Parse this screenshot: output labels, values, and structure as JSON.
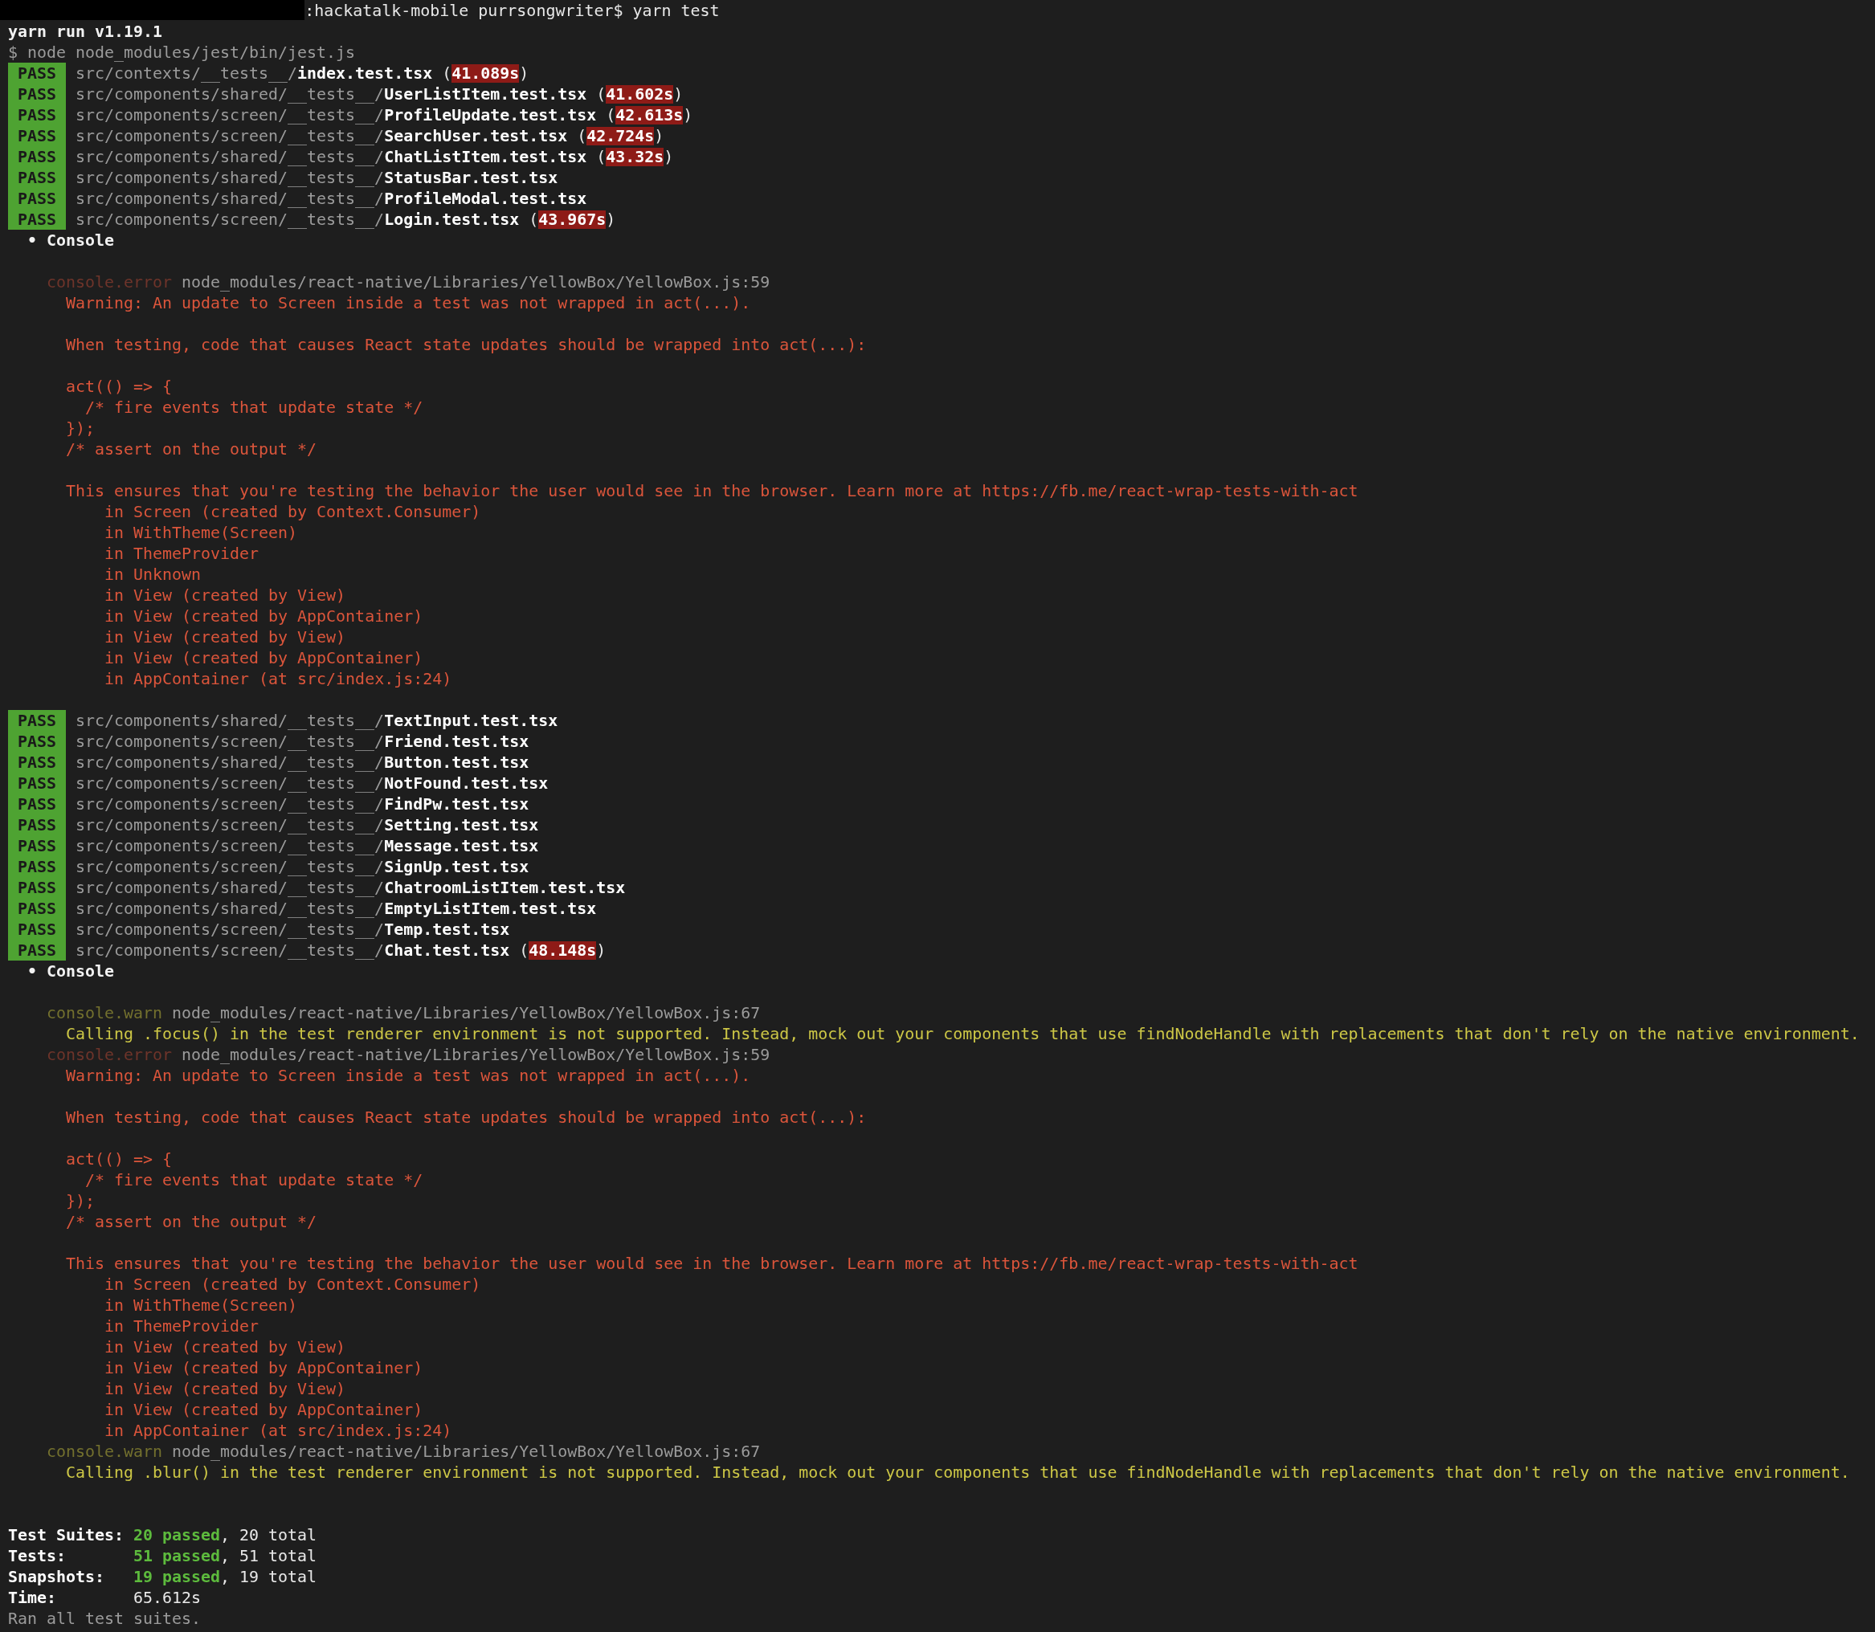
{
  "lines": [
    {
      "kind": "prompt",
      "segments": [
        {
          "kind": "plain",
          "text": ":hackatalk-mobile purrsongwriter$ yarn test"
        }
      ]
    },
    {
      "kind": "text",
      "segments": [
        {
          "kind": "heading",
          "text": "yarn run v1.19.1"
        }
      ]
    },
    {
      "kind": "text",
      "segments": [
        {
          "kind": "dim",
          "text": "$ node node_modules/jest/bin/jest.js"
        }
      ]
    },
    {
      "kind": "pass",
      "badge": "PASS",
      "segments": [
        {
          "kind": "dim",
          "text": "src/contexts/__tests__/"
        },
        {
          "kind": "bold",
          "text": "index.test.tsx"
        },
        {
          "kind": "plain",
          "text": " ("
        },
        {
          "kind": "slow",
          "text": "41.089s"
        },
        {
          "kind": "plain",
          "text": ")"
        }
      ]
    },
    {
      "kind": "pass",
      "badge": "PASS",
      "segments": [
        {
          "kind": "dim",
          "text": "src/components/shared/__tests__/"
        },
        {
          "kind": "bold",
          "text": "UserListItem.test.tsx"
        },
        {
          "kind": "plain",
          "text": " ("
        },
        {
          "kind": "slow",
          "text": "41.602s"
        },
        {
          "kind": "plain",
          "text": ")"
        }
      ]
    },
    {
      "kind": "pass",
      "badge": "PASS",
      "segments": [
        {
          "kind": "dim",
          "text": "src/components/screen/__tests__/"
        },
        {
          "kind": "bold",
          "text": "ProfileUpdate.test.tsx"
        },
        {
          "kind": "plain",
          "text": " ("
        },
        {
          "kind": "slow",
          "text": "42.613s"
        },
        {
          "kind": "plain",
          "text": ")"
        }
      ]
    },
    {
      "kind": "pass",
      "badge": "PASS",
      "segments": [
        {
          "kind": "dim",
          "text": "src/components/screen/__tests__/"
        },
        {
          "kind": "bold",
          "text": "SearchUser.test.tsx"
        },
        {
          "kind": "plain",
          "text": " ("
        },
        {
          "kind": "slow",
          "text": "42.724s"
        },
        {
          "kind": "plain",
          "text": ")"
        }
      ]
    },
    {
      "kind": "pass",
      "badge": "PASS",
      "segments": [
        {
          "kind": "dim",
          "text": "src/components/shared/__tests__/"
        },
        {
          "kind": "bold",
          "text": "ChatListItem.test.tsx"
        },
        {
          "kind": "plain",
          "text": " ("
        },
        {
          "kind": "slow",
          "text": "43.32s"
        },
        {
          "kind": "plain",
          "text": ")"
        }
      ]
    },
    {
      "kind": "pass",
      "badge": "PASS",
      "segments": [
        {
          "kind": "dim",
          "text": "src/components/shared/__tests__/"
        },
        {
          "kind": "bold",
          "text": "StatusBar.test.tsx"
        }
      ]
    },
    {
      "kind": "pass",
      "badge": "PASS",
      "segments": [
        {
          "kind": "dim",
          "text": "src/components/shared/__tests__/"
        },
        {
          "kind": "bold",
          "text": "ProfileModal.test.tsx"
        }
      ]
    },
    {
      "kind": "pass",
      "badge": "PASS",
      "segments": [
        {
          "kind": "dim",
          "text": "src/components/screen/__tests__/"
        },
        {
          "kind": "bold",
          "text": "Login.test.tsx"
        },
        {
          "kind": "plain",
          "text": " ("
        },
        {
          "kind": "slow",
          "text": "43.967s"
        },
        {
          "kind": "plain",
          "text": ")"
        }
      ]
    },
    {
      "kind": "text",
      "segments": [
        {
          "kind": "heading",
          "text": "  • Console"
        }
      ]
    },
    {
      "kind": "blank"
    },
    {
      "kind": "text",
      "segments": [
        {
          "kind": "errlabel",
          "text": "    console.error"
        },
        {
          "kind": "dim",
          "text": " node_modules/react-native/Libraries/YellowBox/YellowBox.js:59"
        }
      ]
    },
    {
      "kind": "text",
      "segments": [
        {
          "kind": "error",
          "text": "      Warning: An update to Screen inside a test was not wrapped in act(...)."
        }
      ]
    },
    {
      "kind": "blank"
    },
    {
      "kind": "text",
      "segments": [
        {
          "kind": "error",
          "text": "      When testing, code that causes React state updates should be wrapped into act(...):"
        }
      ]
    },
    {
      "kind": "blank"
    },
    {
      "kind": "text",
      "segments": [
        {
          "kind": "error",
          "text": "      act(() => {"
        }
      ]
    },
    {
      "kind": "text",
      "segments": [
        {
          "kind": "error",
          "text": "        /* fire events that update state */"
        }
      ]
    },
    {
      "kind": "text",
      "segments": [
        {
          "kind": "error",
          "text": "      });"
        }
      ]
    },
    {
      "kind": "text",
      "segments": [
        {
          "kind": "error",
          "text": "      /* assert on the output */"
        }
      ]
    },
    {
      "kind": "blank"
    },
    {
      "kind": "text",
      "segments": [
        {
          "kind": "error",
          "text": "      This ensures that you're testing the behavior the user would see in the browser. Learn more at https://fb.me/react-wrap-tests-with-act"
        }
      ]
    },
    {
      "kind": "text",
      "segments": [
        {
          "kind": "error",
          "text": "          in Screen (created by Context.Consumer)"
        }
      ]
    },
    {
      "kind": "text",
      "segments": [
        {
          "kind": "error",
          "text": "          in WithTheme(Screen)"
        }
      ]
    },
    {
      "kind": "text",
      "segments": [
        {
          "kind": "error",
          "text": "          in ThemeProvider"
        }
      ]
    },
    {
      "kind": "text",
      "segments": [
        {
          "kind": "error",
          "text": "          in Unknown"
        }
      ]
    },
    {
      "kind": "text",
      "segments": [
        {
          "kind": "error",
          "text": "          in View (created by View)"
        }
      ]
    },
    {
      "kind": "text",
      "segments": [
        {
          "kind": "error",
          "text": "          in View (created by AppContainer)"
        }
      ]
    },
    {
      "kind": "text",
      "segments": [
        {
          "kind": "error",
          "text": "          in View (created by View)"
        }
      ]
    },
    {
      "kind": "text",
      "segments": [
        {
          "kind": "error",
          "text": "          in View (created by AppContainer)"
        }
      ]
    },
    {
      "kind": "text",
      "segments": [
        {
          "kind": "error",
          "text": "          in AppContainer (at src/index.js:24)"
        }
      ]
    },
    {
      "kind": "blank"
    },
    {
      "kind": "pass",
      "badge": "PASS",
      "segments": [
        {
          "kind": "dim",
          "text": "src/components/shared/__tests__/"
        },
        {
          "kind": "bold",
          "text": "TextInput.test.tsx"
        }
      ]
    },
    {
      "kind": "pass",
      "badge": "PASS",
      "segments": [
        {
          "kind": "dim",
          "text": "src/components/screen/__tests__/"
        },
        {
          "kind": "bold",
          "text": "Friend.test.tsx"
        }
      ]
    },
    {
      "kind": "pass",
      "badge": "PASS",
      "segments": [
        {
          "kind": "dim",
          "text": "src/components/shared/__tests__/"
        },
        {
          "kind": "bold",
          "text": "Button.test.tsx"
        }
      ]
    },
    {
      "kind": "pass",
      "badge": "PASS",
      "segments": [
        {
          "kind": "dim",
          "text": "src/components/screen/__tests__/"
        },
        {
          "kind": "bold",
          "text": "NotFound.test.tsx"
        }
      ]
    },
    {
      "kind": "pass",
      "badge": "PASS",
      "segments": [
        {
          "kind": "dim",
          "text": "src/components/screen/__tests__/"
        },
        {
          "kind": "bold",
          "text": "FindPw.test.tsx"
        }
      ]
    },
    {
      "kind": "pass",
      "badge": "PASS",
      "segments": [
        {
          "kind": "dim",
          "text": "src/components/screen/__tests__/"
        },
        {
          "kind": "bold",
          "text": "Setting.test.tsx"
        }
      ]
    },
    {
      "kind": "pass",
      "badge": "PASS",
      "segments": [
        {
          "kind": "dim",
          "text": "src/components/screen/__tests__/"
        },
        {
          "kind": "bold",
          "text": "Message.test.tsx"
        }
      ]
    },
    {
      "kind": "pass",
      "badge": "PASS",
      "segments": [
        {
          "kind": "dim",
          "text": "src/components/screen/__tests__/"
        },
        {
          "kind": "bold",
          "text": "SignUp.test.tsx"
        }
      ]
    },
    {
      "kind": "pass",
      "badge": "PASS",
      "segments": [
        {
          "kind": "dim",
          "text": "src/components/shared/__tests__/"
        },
        {
          "kind": "bold",
          "text": "ChatroomListItem.test.tsx"
        }
      ]
    },
    {
      "kind": "pass",
      "badge": "PASS",
      "segments": [
        {
          "kind": "dim",
          "text": "src/components/shared/__tests__/"
        },
        {
          "kind": "bold",
          "text": "EmptyListItem.test.tsx"
        }
      ]
    },
    {
      "kind": "pass",
      "badge": "PASS",
      "segments": [
        {
          "kind": "dim",
          "text": "src/components/screen/__tests__/"
        },
        {
          "kind": "bold",
          "text": "Temp.test.tsx"
        }
      ]
    },
    {
      "kind": "pass",
      "badge": "PASS",
      "segments": [
        {
          "kind": "dim",
          "text": "src/components/screen/__tests__/"
        },
        {
          "kind": "bold",
          "text": "Chat.test.tsx"
        },
        {
          "kind": "plain",
          "text": " ("
        },
        {
          "kind": "slow",
          "text": "48.148s"
        },
        {
          "kind": "plain",
          "text": ")"
        }
      ]
    },
    {
      "kind": "text",
      "segments": [
        {
          "kind": "heading",
          "text": "  • Console"
        }
      ]
    },
    {
      "kind": "blank"
    },
    {
      "kind": "text",
      "segments": [
        {
          "kind": "warnlabel",
          "text": "    console.warn"
        },
        {
          "kind": "dim",
          "text": " node_modules/react-native/Libraries/YellowBox/YellowBox.js:67"
        }
      ]
    },
    {
      "kind": "text",
      "segments": [
        {
          "kind": "warn",
          "text": "      Calling .focus() in the test renderer environment is not supported. Instead, mock out your components that use findNodeHandle with replacements that don't rely on the native environment."
        }
      ]
    },
    {
      "kind": "text",
      "segments": [
        {
          "kind": "errlabel",
          "text": "    console.error"
        },
        {
          "kind": "dim",
          "text": " node_modules/react-native/Libraries/YellowBox/YellowBox.js:59"
        }
      ]
    },
    {
      "kind": "text",
      "segments": [
        {
          "kind": "error",
          "text": "      Warning: An update to Screen inside a test was not wrapped in act(...)."
        }
      ]
    },
    {
      "kind": "blank"
    },
    {
      "kind": "text",
      "segments": [
        {
          "kind": "error",
          "text": "      When testing, code that causes React state updates should be wrapped into act(...):"
        }
      ]
    },
    {
      "kind": "blank"
    },
    {
      "kind": "text",
      "segments": [
        {
          "kind": "error",
          "text": "      act(() => {"
        }
      ]
    },
    {
      "kind": "text",
      "segments": [
        {
          "kind": "error",
          "text": "        /* fire events that update state */"
        }
      ]
    },
    {
      "kind": "text",
      "segments": [
        {
          "kind": "error",
          "text": "      });"
        }
      ]
    },
    {
      "kind": "text",
      "segments": [
        {
          "kind": "error",
          "text": "      /* assert on the output */"
        }
      ]
    },
    {
      "kind": "blank"
    },
    {
      "kind": "text",
      "segments": [
        {
          "kind": "error",
          "text": "      This ensures that you're testing the behavior the user would see in the browser. Learn more at https://fb.me/react-wrap-tests-with-act"
        }
      ]
    },
    {
      "kind": "text",
      "segments": [
        {
          "kind": "error",
          "text": "          in Screen (created by Context.Consumer)"
        }
      ]
    },
    {
      "kind": "text",
      "segments": [
        {
          "kind": "error",
          "text": "          in WithTheme(Screen)"
        }
      ]
    },
    {
      "kind": "text",
      "segments": [
        {
          "kind": "error",
          "text": "          in ThemeProvider"
        }
      ]
    },
    {
      "kind": "text",
      "segments": [
        {
          "kind": "error",
          "text": "          in View (created by View)"
        }
      ]
    },
    {
      "kind": "text",
      "segments": [
        {
          "kind": "error",
          "text": "          in View (created by AppContainer)"
        }
      ]
    },
    {
      "kind": "text",
      "segments": [
        {
          "kind": "error",
          "text": "          in View (created by View)"
        }
      ]
    },
    {
      "kind": "text",
      "segments": [
        {
          "kind": "error",
          "text": "          in View (created by AppContainer)"
        }
      ]
    },
    {
      "kind": "text",
      "segments": [
        {
          "kind": "error",
          "text": "          in AppContainer (at src/index.js:24)"
        }
      ]
    },
    {
      "kind": "text",
      "segments": [
        {
          "kind": "warnlabel",
          "text": "    console.warn"
        },
        {
          "kind": "dim",
          "text": " node_modules/react-native/Libraries/YellowBox/YellowBox.js:67"
        }
      ]
    },
    {
      "kind": "text",
      "segments": [
        {
          "kind": "warn",
          "text": "      Calling .blur() in the test renderer environment is not supported. Instead, mock out your components that use findNodeHandle with replacements that don't rely on the native environment."
        }
      ]
    },
    {
      "kind": "blank"
    },
    {
      "kind": "blank"
    },
    {
      "kind": "text",
      "segments": [
        {
          "kind": "label",
          "text": "Test Suites: "
        },
        {
          "kind": "passed",
          "text": "20 passed"
        },
        {
          "kind": "plain",
          "text": ", 20 total"
        }
      ]
    },
    {
      "kind": "text",
      "segments": [
        {
          "kind": "label",
          "text": "Tests:       "
        },
        {
          "kind": "passed",
          "text": "51 passed"
        },
        {
          "kind": "plain",
          "text": ", 51 total"
        }
      ]
    },
    {
      "kind": "text",
      "segments": [
        {
          "kind": "label",
          "text": "Snapshots:   "
        },
        {
          "kind": "passed",
          "text": "19 passed"
        },
        {
          "kind": "plain",
          "text": ", 19 total"
        }
      ]
    },
    {
      "kind": "text",
      "segments": [
        {
          "kind": "label",
          "text": "Time:        "
        },
        {
          "kind": "plain",
          "text": "65.612s"
        }
      ]
    },
    {
      "kind": "text",
      "segments": [
        {
          "kind": "dim",
          "text": "Ran all test suites."
        }
      ]
    }
  ]
}
